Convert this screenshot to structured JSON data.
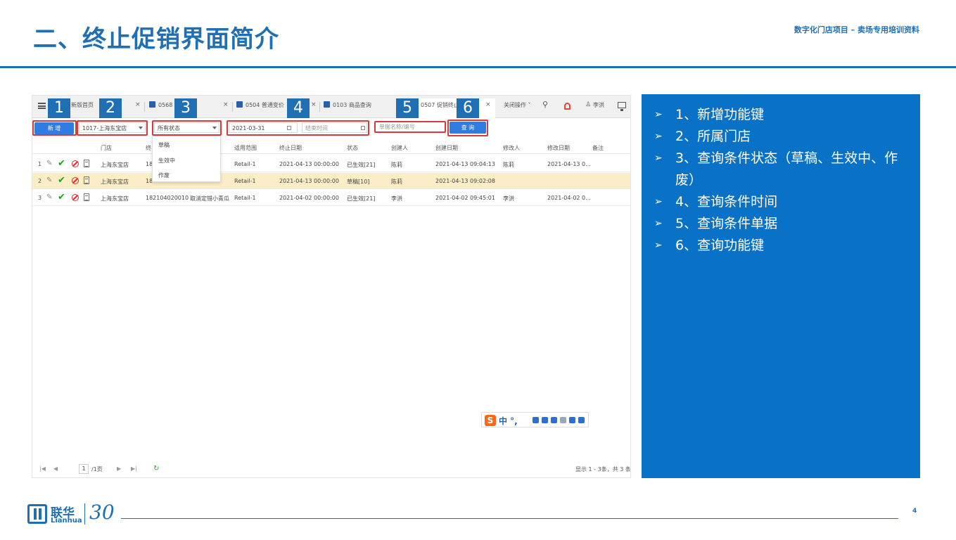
{
  "slide": {
    "title": "二、终止促销界面简介",
    "subtitle": "数字化门店项目 – 卖场专用培训资料",
    "page_number": "4"
  },
  "tabs": [
    {
      "label": "新版首页"
    },
    {
      "label": "0568 报...询"
    },
    {
      "label": "0504 普通变价"
    },
    {
      "label": "0103 商品查询"
    },
    {
      "label": "0507 促销终止"
    }
  ],
  "topbar": {
    "close_ops": "关闭操作 ˅",
    "user": "李洪"
  },
  "callouts": [
    "1",
    "2",
    "3",
    "4",
    "5",
    "6"
  ],
  "filter": {
    "add_button": "新 增",
    "store_value": "1017-上海东宝店",
    "status_value": "所有状态",
    "start_date": "2021-03-31",
    "end_date_placeholder": "结束时间",
    "doc_placeholder": "单据名称/编号",
    "query_button": "查 询"
  },
  "status_options": [
    "草稿",
    "生效中",
    "作废"
  ],
  "table": {
    "columns": [
      "门店",
      "终",
      "",
      "适用范围",
      "终止日期",
      "状态",
      "创建人",
      "创建日期",
      "修改人",
      "修改日期",
      "备注"
    ],
    "rows": [
      {
        "num": "1",
        "store": "上海东宝店",
        "code": "18",
        "name": "",
        "scope": "Retail-1",
        "end_date": "2021-04-13 00:00:00",
        "status": "已生效[21]",
        "creator": "陈莉",
        "created": "2021-04-13 09:04:13",
        "modifier": "陈莉",
        "modified": "2021-04-13 0..."
      },
      {
        "num": "2",
        "store": "上海东宝店",
        "code": "18",
        "name": "",
        "scope": "Retail-1",
        "end_date": "2021-04-13 00:00:00",
        "status": "草稿[10]",
        "creator": "陈莉",
        "created": "2021-04-13 09:02:08",
        "modifier": "",
        "modified": ""
      },
      {
        "num": "3",
        "store": "上海东宝店",
        "code": "182104020010",
        "name": "取消定错小青瓜",
        "scope": "Retail-1",
        "end_date": "2021-04-02 00:00:00",
        "status": "已生效[21]",
        "creator": "李洪",
        "created": "2021-04-02 09:45:01",
        "modifier": "李洪",
        "modified": "2021-04-02 0..."
      }
    ]
  },
  "ime": {
    "logo": "S",
    "mode": "中 °,"
  },
  "pager": {
    "page": "1",
    "total_pages": "/1页",
    "summary": "显示 1 - 3条，共 3 条"
  },
  "notes": [
    "1、新增功能键",
    "2、所属门店",
    "3、查询条件状态（草稿、生效中、作废）",
    "4、查询条件时间",
    "5、查询条件单据",
    "6、查询功能键"
  ],
  "footer": {
    "logo_cn": "联华",
    "logo_en": "Lianhua",
    "logo_30": "30"
  },
  "colors": {
    "brand_blue": "#1f6fb2",
    "notes_bg": "#0a72c6",
    "highlight_row": "#fbeec6",
    "callout_red": "#d63a3a"
  }
}
